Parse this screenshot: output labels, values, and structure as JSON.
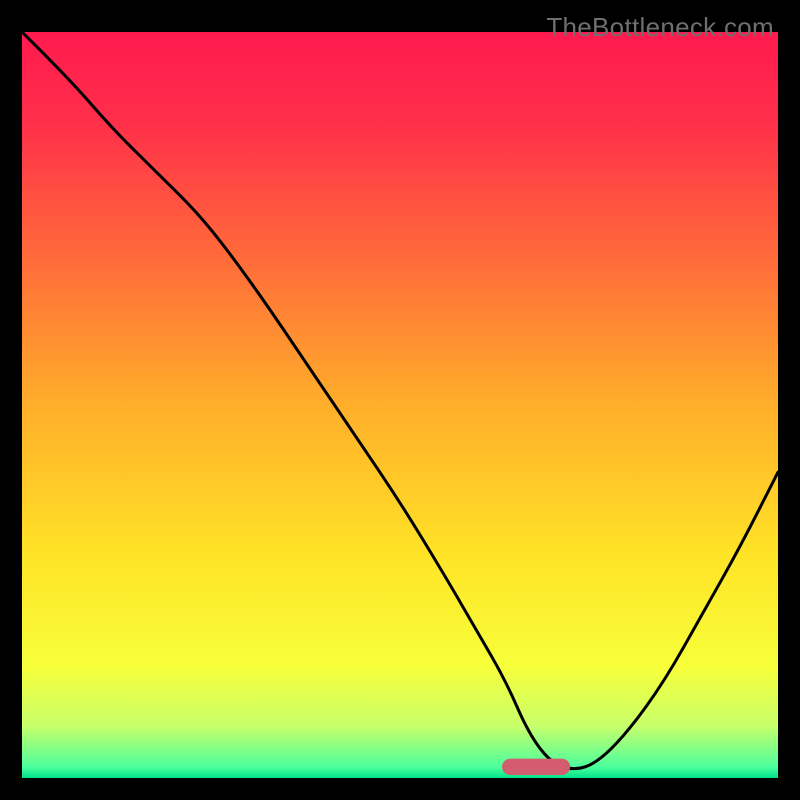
{
  "watermark": "TheBottleneck.com",
  "chart_data": {
    "type": "line",
    "title": "",
    "xlabel": "",
    "ylabel": "",
    "xlim": [
      0,
      100
    ],
    "ylim": [
      0,
      100
    ],
    "grid": false,
    "legend": false,
    "gradient_stops": [
      {
        "offset": 0.0,
        "color": "#ff1a4e"
      },
      {
        "offset": 0.12,
        "color": "#ff2f4a"
      },
      {
        "offset": 0.3,
        "color": "#ff6a3a"
      },
      {
        "offset": 0.5,
        "color": "#ffae2a"
      },
      {
        "offset": 0.7,
        "color": "#ffe326"
      },
      {
        "offset": 0.85,
        "color": "#f7ff3a"
      },
      {
        "offset": 0.93,
        "color": "#c8ff6a"
      },
      {
        "offset": 0.985,
        "color": "#4dff9d"
      },
      {
        "offset": 1.0,
        "color": "#00e38a"
      }
    ],
    "marker": {
      "x": 68,
      "y": 1.5,
      "width": 9,
      "height": 2.2,
      "rx": 1.1,
      "color": "#d35c6e"
    },
    "series": [
      {
        "name": "bottleneck-curve",
        "color": "#000000",
        "x": [
          0,
          6,
          12,
          18,
          23,
          27,
          32,
          38,
          44,
          50,
          56,
          60,
          64,
          67,
          70,
          73,
          76,
          80,
          85,
          90,
          95,
          100
        ],
        "y": [
          100,
          94,
          87,
          81,
          76,
          71,
          64,
          55,
          46,
          37,
          27,
          20,
          13,
          6,
          2,
          1,
          2,
          6,
          13,
          22,
          31,
          41
        ]
      }
    ]
  }
}
